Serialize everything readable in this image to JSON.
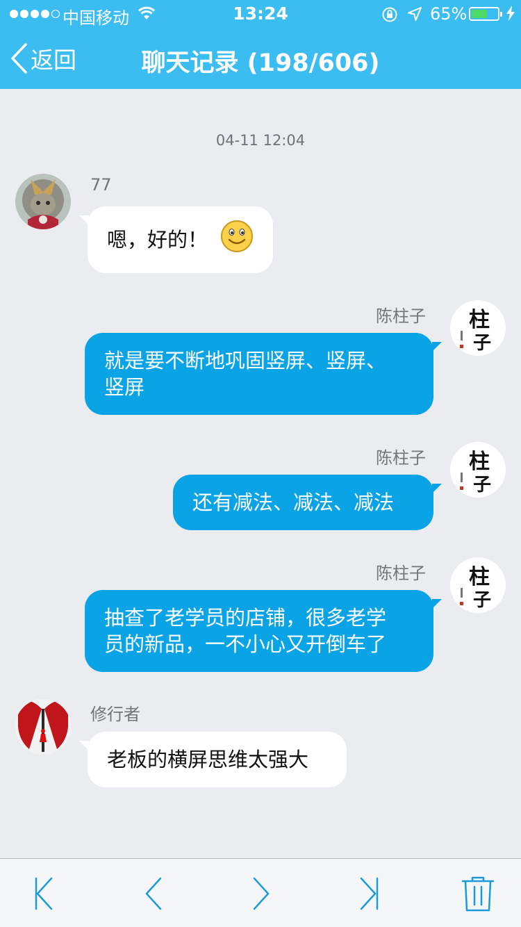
{
  "status_bar": {
    "carrier": "中国移动",
    "time": "13:24",
    "battery_percent": "65%",
    "battery_level": 0.65
  },
  "nav": {
    "back_label": "返回",
    "title": "聊天记录 (198/606)"
  },
  "chat": {
    "timestamp": "04-11 12:04",
    "messages": [
      {
        "sender": "77",
        "text": "嗯，好的！",
        "direction": "incoming",
        "emoji": "smile-emoji"
      },
      {
        "sender": "陈柱子",
        "line1": "就是要不断地巩固竖屏、竖屏、",
        "line2": "竖屏",
        "direction": "outgoing"
      },
      {
        "sender": "陈柱子",
        "text": "还有减法、减法、减法",
        "direction": "outgoing"
      },
      {
        "sender": "陈柱子",
        "line1": "抽查了老学员的店铺，很多老学",
        "line2": "员的新品，一不小心又开倒车了",
        "direction": "outgoing"
      },
      {
        "sender": "修行者",
        "text": "老板的横屏思维太强大",
        "direction": "incoming"
      }
    ],
    "avatar_chenzhuzi_text": "柱子"
  },
  "toolbar": {
    "icons": [
      "first-page-icon",
      "prev-page-icon",
      "next-page-icon",
      "last-page-icon",
      "trash-icon"
    ]
  },
  "colors": {
    "header": "#3cbdf2",
    "outgoing_bubble": "#0aa3e6",
    "incoming_bubble": "#ffffff",
    "background": "#ebecf0",
    "toolbar_icon": "#1a9bd7"
  }
}
